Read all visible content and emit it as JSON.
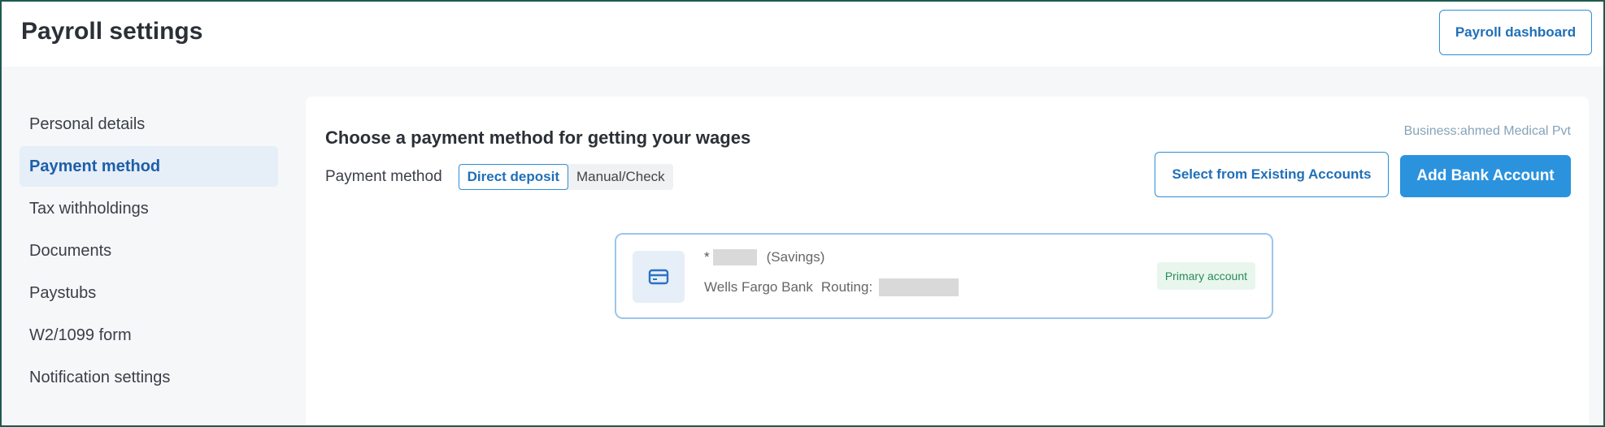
{
  "header": {
    "title": "Payroll settings",
    "dashboard_button": "Payroll dashboard"
  },
  "sidebar": {
    "items": [
      {
        "label": "Personal details",
        "active": false
      },
      {
        "label": "Payment method",
        "active": true
      },
      {
        "label": "Tax withholdings",
        "active": false
      },
      {
        "label": "Documents",
        "active": false
      },
      {
        "label": "Paystubs",
        "active": false
      },
      {
        "label": "W2/1099 form",
        "active": false
      },
      {
        "label": "Notification settings",
        "active": false
      }
    ]
  },
  "main": {
    "heading": "Choose a payment method for getting your wages",
    "business": "Business:ahmed Medical Pvt",
    "payment_method_label": "Payment method",
    "options": [
      {
        "label": "Direct deposit",
        "selected": true
      },
      {
        "label": "Manual/Check",
        "selected": false
      }
    ],
    "select_existing_button": "Select from Existing Accounts",
    "add_bank_button": "Add Bank Account",
    "account": {
      "icon": "card-icon",
      "number_prefix": "*",
      "type": "(Savings)",
      "bank": "Wells Fargo Bank",
      "routing_label": "Routing:",
      "badge": "Primary account"
    }
  },
  "colors": {
    "accent": "#2b92de",
    "border_frame": "#1e5a4e",
    "active_nav_bg": "#e6eef8",
    "badge_bg": "#e8f6ee"
  }
}
